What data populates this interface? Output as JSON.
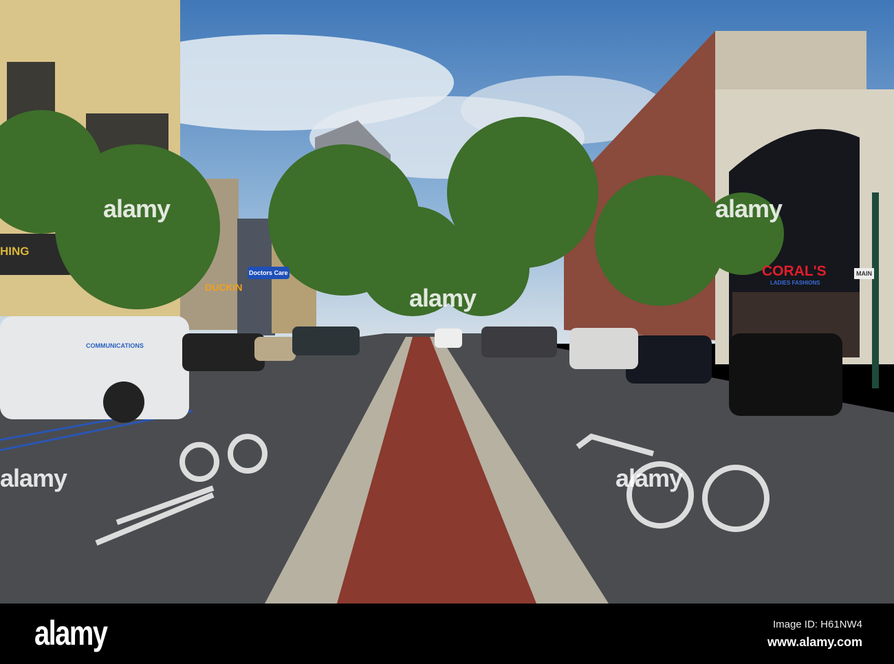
{
  "photo": {
    "signs": {
      "store": "CORAL'S",
      "store_sub": "LADIES FASHIONS",
      "clinic": "Doctors Care",
      "coffee": "DUCKIN",
      "van": "COMMUNICATIONS",
      "banner": "MAIN",
      "left_building": "HING"
    },
    "watermark": "alamy"
  },
  "footer": {
    "logo": "alamy",
    "image_id": "Image ID: H61NW4",
    "website": "www.alamy.com"
  }
}
